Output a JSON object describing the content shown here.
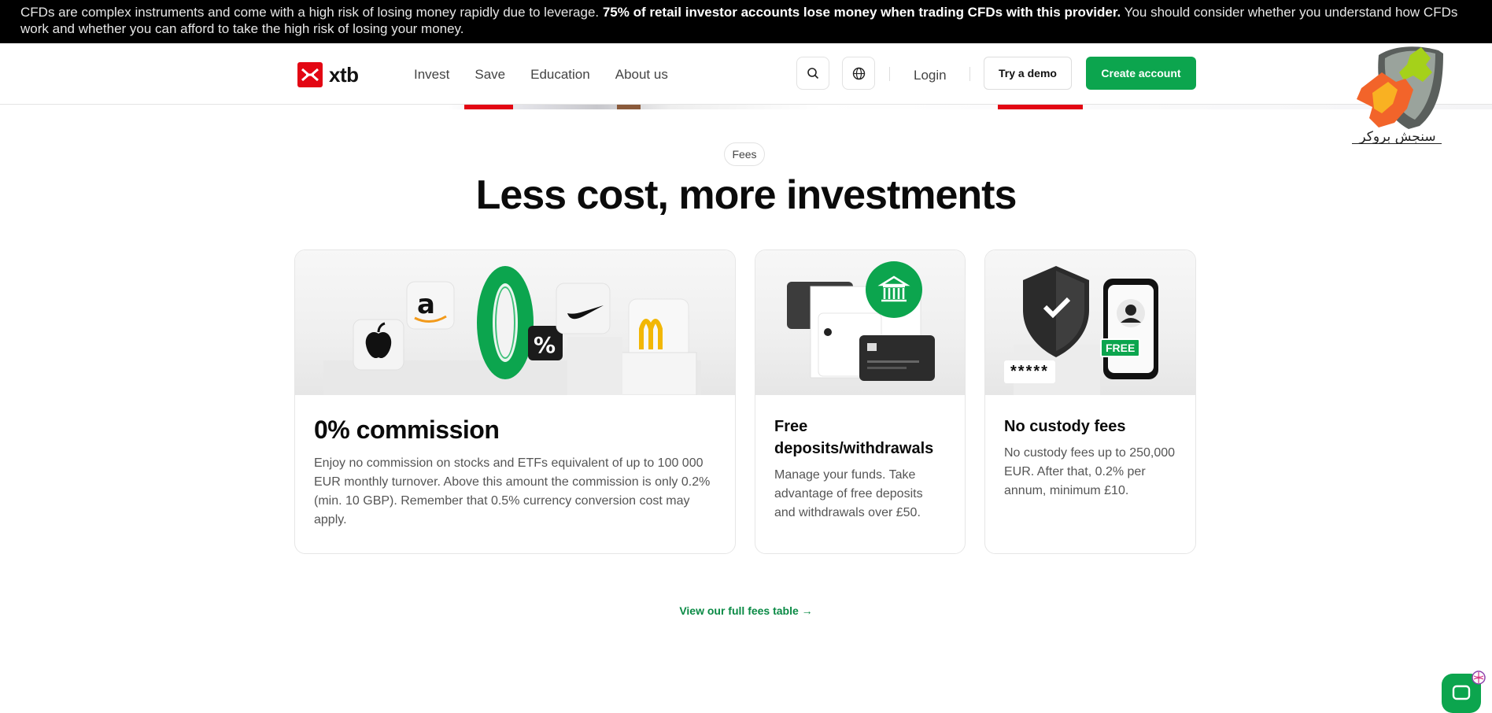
{
  "risk_banner": {
    "text_before": "CFDs are complex instruments and come with a high risk of losing money rapidly due to leverage. ",
    "text_bold": "75% of retail investor accounts lose money when trading CFDs with this provider.",
    "text_after": " You should consider whether you understand how CFDs work and whether you can afford to take the high risk of losing your money."
  },
  "header": {
    "logo_text": "xtb",
    "nav": [
      "Invest",
      "Save",
      "Education",
      "About us"
    ],
    "search_icon": "search-icon",
    "language_icon": "globe-icon",
    "login_label": "Login",
    "demo_label": "Try a demo",
    "create_label": "Create account"
  },
  "watermark": {
    "text": "سنجش بروکر"
  },
  "section": {
    "pill": "Fees",
    "title": "Less cost, more investments"
  },
  "cards": [
    {
      "title": "0% commission",
      "body": "Enjoy no commission on stocks and ETFs equivalent of up to 100 000 EUR monthly turnover. Above this amount the commission is only 0.2% (min. 10 GBP). Remember that 0.5% currency conversion cost may apply."
    },
    {
      "title": "Free deposits/withdrawals",
      "body": "Manage your funds. Take advantage of free deposits and withdrawals over £50."
    },
    {
      "title": "No custody fees",
      "body": "No custody fees up to 250,000 EUR. After that, 0.2% per annum, minimum £10.",
      "badge": "FREE",
      "password_mask": "*****"
    }
  ],
  "card1_image": {
    "percent": "%"
  },
  "fees_link": "View our full fees table →",
  "colors": {
    "brand_red": "#e30613",
    "brand_green": "#0ca54e",
    "link_green": "#0a8a45"
  }
}
